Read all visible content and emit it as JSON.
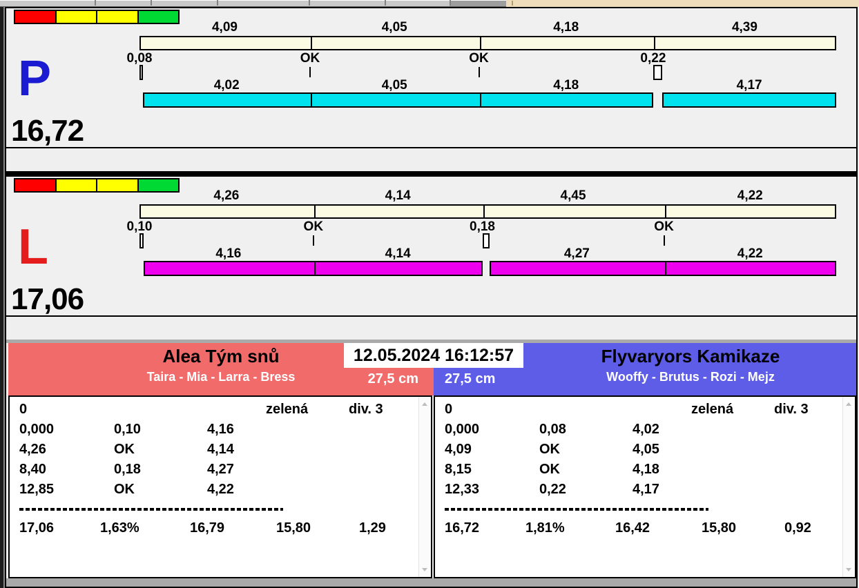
{
  "titlebar": {
    "datetime": "12.05.2024 16:12:57",
    "accent_peach": "#efddbb"
  },
  "traffic_colors": [
    "#ff0000",
    "#ffff00",
    "#ffff00",
    "#00d934"
  ],
  "split_track_color": "#fbfae2",
  "lanes": [
    {
      "letter": "P",
      "letter_color": "#1b1bd1",
      "total": "16,72",
      "run_color": "#00e3ee",
      "splits": [
        "4,09",
        "4,05",
        "4,18",
        "4,39"
      ],
      "markers": [
        "0,08",
        "OK",
        "OK",
        "0,22"
      ],
      "runs": [
        "4,02",
        "4,05",
        "4,18",
        "4,17"
      ]
    },
    {
      "letter": "L",
      "letter_color": "#e41c1c",
      "total": "17,06",
      "run_color": "#ee00ee",
      "splits": [
        "4,26",
        "4,14",
        "4,45",
        "4,22"
      ],
      "markers": [
        "0,10",
        "OK",
        "0,18",
        "OK"
      ],
      "runs": [
        "4,16",
        "4,14",
        "4,27",
        "4,22"
      ]
    }
  ],
  "teams": [
    {
      "name": "Alea Tým snů",
      "dogs": "Taira - Mia - Larra - Bress",
      "height": "27,5 cm",
      "color": "#f26b6b",
      "table": {
        "info": [
          "0",
          "zelená",
          "div. 3"
        ],
        "rows": [
          [
            "0,000",
            "0,10",
            "4,16"
          ],
          [
            "4,26",
            "OK",
            "4,14"
          ],
          [
            "8,40",
            "0,18",
            "4,27"
          ],
          [
            "12,85",
            "OK",
            "4,22"
          ]
        ],
        "summary": [
          "17,06",
          "1,63%",
          "16,79",
          "15,80",
          "1,29"
        ]
      }
    },
    {
      "name": "Flyvaryors Kamikaze",
      "dogs": "Wooffy - Brutus - Rozi - Mejz",
      "height": "27,5 cm",
      "color": "#5d5de8",
      "table": {
        "info": [
          "0",
          "zelená",
          "div. 3"
        ],
        "rows": [
          [
            "0,000",
            "0,08",
            "4,02"
          ],
          [
            "4,09",
            "OK",
            "4,05"
          ],
          [
            "8,15",
            "OK",
            "4,18"
          ],
          [
            "12,33",
            "0,22",
            "4,17"
          ]
        ],
        "summary": [
          "16,72",
          "1,81%",
          "16,42",
          "15,80",
          "0,92"
        ]
      }
    }
  ]
}
